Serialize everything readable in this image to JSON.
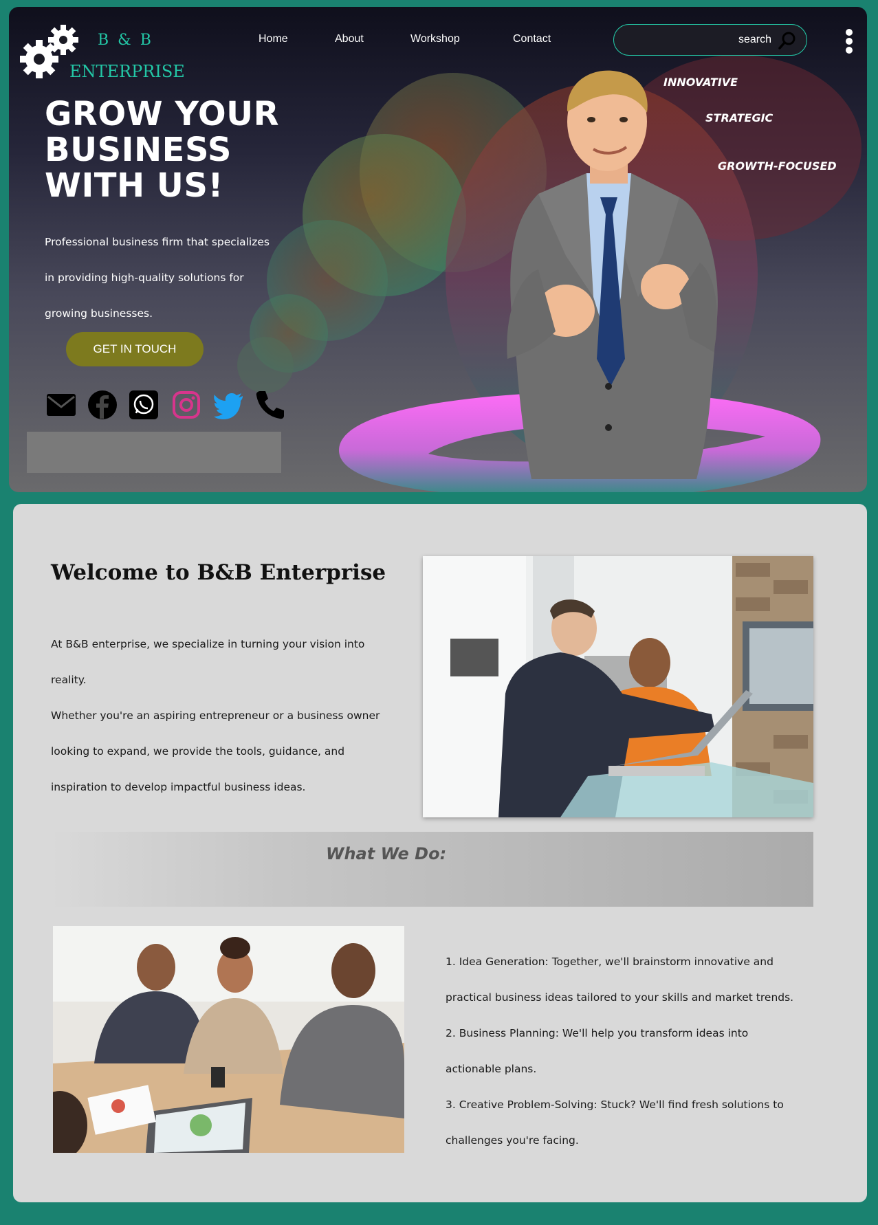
{
  "brand": {
    "line1": "B & B",
    "line2": "ENTERPRISE",
    "accent": "#23c7a6"
  },
  "nav": {
    "home": "Home",
    "about": "About",
    "workshop": "Workshop",
    "contact": "Contact"
  },
  "search": {
    "placeholder": "search"
  },
  "hero": {
    "headline": [
      "GROW YOUR",
      "BUSINESS",
      "WITH US!"
    ],
    "description": [
      "Professional business firm that specializes",
      "in providing high-quality solutions for",
      "growing businesses."
    ],
    "cta": "GET IN TOUCH",
    "tags": [
      "INNOVATIVE",
      "STRATEGIC",
      "GROWTH-FOCUSED"
    ],
    "socials": [
      "mail-icon",
      "facebook-icon",
      "whatsapp-icon",
      "instagram-icon",
      "twitter-icon",
      "phone-icon"
    ]
  },
  "welcome": {
    "title": "Welcome to B&B Enterprise",
    "paragraph": [
      "At B&B enterprise, we specialize in turning your vision into",
      "reality.",
      "Whether you're an aspiring entrepreneur or a business owner",
      "looking to expand, we provide the tools, guidance, and",
      "inspiration to develop impactful business ideas."
    ]
  },
  "what_we_do": {
    "title": "What We Do:",
    "items": [
      "1. Idea Generation: Together, we'll brainstorm innovative and",
      "practical business ideas tailored to your skills and market trends.",
      "2. Business Planning: We'll help you transform ideas into",
      "actionable plans.",
      "3. Creative Problem-Solving: Stuck? We'll find fresh solutions to",
      "challenges you're facing."
    ]
  },
  "colors": {
    "page_bg": "#1a8270",
    "cta": "#7d7a1e",
    "panel": "#d9d9d9"
  }
}
